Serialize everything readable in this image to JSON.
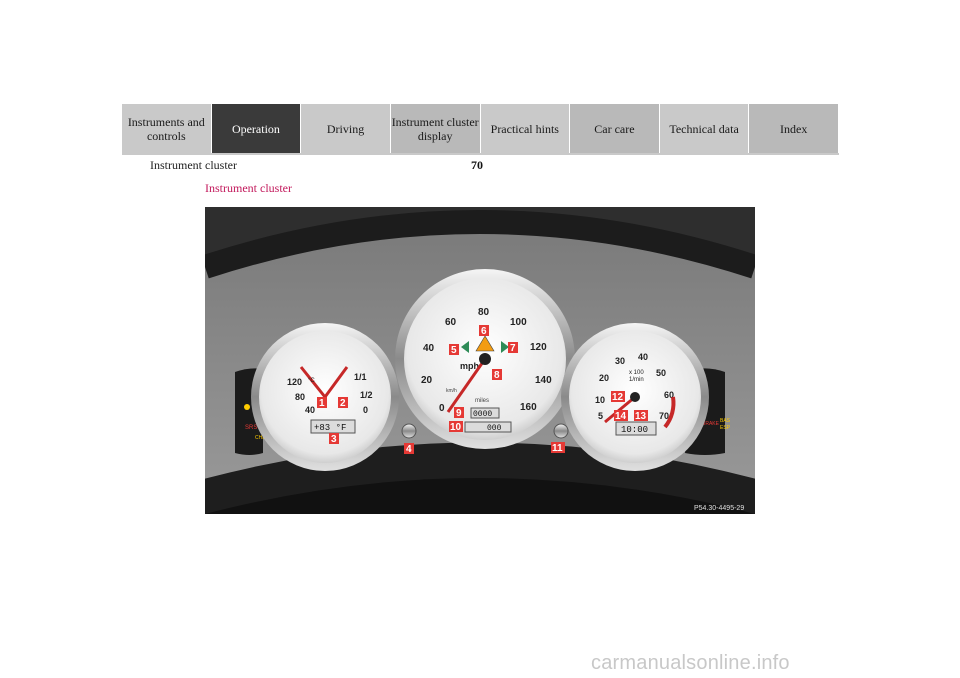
{
  "tabs": [
    {
      "label": "Instruments and controls",
      "active": false
    },
    {
      "label": "Operation",
      "active": true
    },
    {
      "label": "Driving",
      "active": false
    },
    {
      "label": "Instrument cluster display",
      "active": false
    },
    {
      "label": "Practical hints",
      "active": false
    },
    {
      "label": "Car care",
      "active": false
    },
    {
      "label": "Technical data",
      "active": false
    },
    {
      "label": "Index",
      "active": false
    }
  ],
  "header": {
    "section": "Instrument cluster",
    "page_number": "70"
  },
  "title": "Instrument cluster",
  "figure": {
    "code": "P54.30-4495-29",
    "callouts": [
      "1",
      "2",
      "3",
      "4",
      "5",
      "6",
      "7",
      "8",
      "9",
      "10",
      "11",
      "12",
      "13",
      "14"
    ],
    "speedometer": {
      "unit": "mph",
      "odometer_unit": "miles",
      "mph_ticks": [
        "0",
        "20",
        "40",
        "60",
        "80",
        "100",
        "120",
        "140",
        "160"
      ],
      "kmh_unit": "km/h",
      "kmh_ticks": [
        "20",
        "40",
        "60",
        "80",
        "100",
        "120",
        "140",
        "160",
        "200",
        "220",
        "240",
        "260"
      ],
      "odometer": "0000",
      "trip": "000"
    },
    "tachometer": {
      "unit_line1": "x 100",
      "unit_line2": "1/min",
      "ticks": [
        "5",
        "10",
        "20",
        "30",
        "40",
        "50",
        "60",
        "70"
      ],
      "clock": "10:00"
    },
    "left_gauge": {
      "temp_ticks": [
        "120",
        "80",
        "40"
      ],
      "temp_unit": "°C",
      "fuel_ticks": [
        "1/1",
        "1/2",
        "0"
      ],
      "outside_temp": "+83 °F"
    },
    "warning_labels": {
      "srs": "SRS",
      "check_engine": "CHECK ENGINE",
      "brake": "BRAKE",
      "bas": "BAS",
      "esp": "ESP"
    },
    "colors": {
      "callout": "#e53935",
      "needle": "#c62828",
      "background": "#2e2e2e"
    }
  },
  "watermark": "carmanualsonline.info"
}
